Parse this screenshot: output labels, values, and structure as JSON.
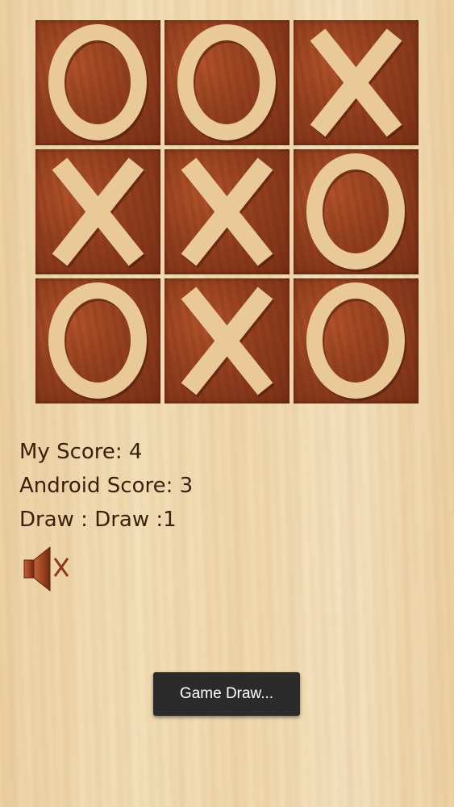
{
  "board": {
    "cells": [
      "O",
      "O",
      "X",
      "X",
      "X",
      "O",
      "O",
      "X",
      "O"
    ]
  },
  "scores": {
    "my": "My Score: 4",
    "android": "Android Score: 3",
    "draw": "Draw : Draw :1"
  },
  "sound": {
    "icon": "speaker-muted-icon",
    "muted": true
  },
  "toast": {
    "text": "Game Draw..."
  },
  "colors": {
    "background": "#f0d8ac",
    "cell": "#94401f",
    "mark": "#e9c997",
    "text": "#3a1f0c",
    "toast": "#2b2b2b"
  }
}
